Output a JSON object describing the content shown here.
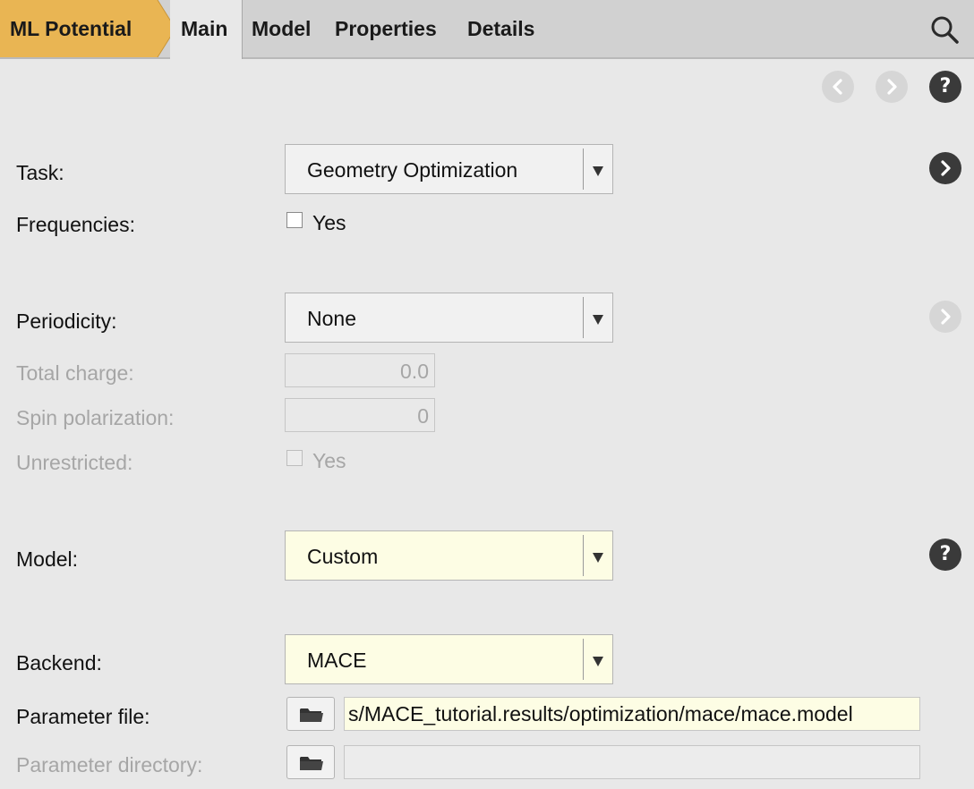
{
  "breadcrumb": {
    "label": "ML Potential"
  },
  "tabs": [
    {
      "label": "Main",
      "active": true
    },
    {
      "label": "Model"
    },
    {
      "label": "Properties"
    },
    {
      "label": "Details"
    }
  ],
  "icons": {
    "search": "search-icon",
    "back": "chevron-left-icon",
    "forward": "chevron-right-icon",
    "help": "help-icon",
    "folder": "folder-icon"
  },
  "colors": {
    "breadcrumb": "#e9b553",
    "input_highlight": "#fdfde4",
    "circle_dark": "#3a3a3a",
    "circle_disabled": "#d6d6d6"
  },
  "help": {
    "symbol": "?"
  },
  "form": {
    "task": {
      "label": "Task:",
      "value": "Geometry Optimization"
    },
    "frequencies": {
      "label": "Frequencies:",
      "checkbox_label": "Yes",
      "checked": false
    },
    "periodicity": {
      "label": "Periodicity:",
      "value": "None"
    },
    "total_charge": {
      "label": "Total charge:",
      "value": "0.0",
      "disabled": true
    },
    "spin_polarization": {
      "label": "Spin polarization:",
      "value": "0",
      "disabled": true
    },
    "unrestricted": {
      "label": "Unrestricted:",
      "checkbox_label": "Yes",
      "checked": false,
      "disabled": true
    },
    "model": {
      "label": "Model:",
      "value": "Custom"
    },
    "backend": {
      "label": "Backend:",
      "value": "MACE"
    },
    "parameter_file": {
      "label": "Parameter file:",
      "value": "s/MACE_tutorial.results/optimization/mace/mace.model"
    },
    "parameter_directory": {
      "label": "Parameter directory:",
      "value": "",
      "disabled": true
    }
  }
}
